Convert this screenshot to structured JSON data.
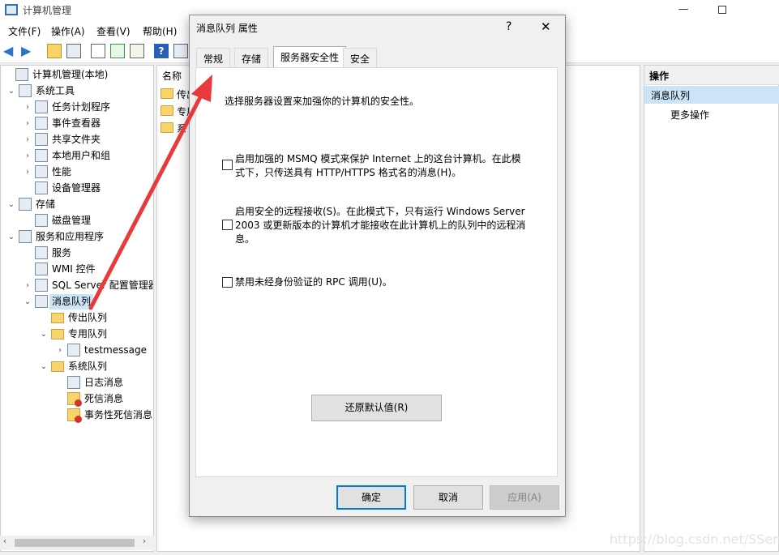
{
  "app": {
    "title": "计算机管理"
  },
  "menu": [
    "文件(F)",
    "操作(A)",
    "查看(V)",
    "帮助(H)"
  ],
  "tree": {
    "items": [
      {
        "label": "计算机管理(本地)",
        "chev": "",
        "level": 0,
        "icon": "computer-icon"
      },
      {
        "label": "系统工具",
        "chev": "⌄",
        "level": 1,
        "icon": "tools-icon"
      },
      {
        "label": "任务计划程序",
        "chev": "›",
        "level": 2,
        "icon": "clock-icon"
      },
      {
        "label": "事件查看器",
        "chev": "›",
        "level": 2,
        "icon": "event-viewer-icon"
      },
      {
        "label": "共享文件夹",
        "chev": "›",
        "level": 2,
        "icon": "shared-folder-icon"
      },
      {
        "label": "本地用户和组",
        "chev": "›",
        "level": 2,
        "icon": "users-icon"
      },
      {
        "label": "性能",
        "chev": "›",
        "level": 2,
        "icon": "performance-icon"
      },
      {
        "label": "设备管理器",
        "chev": "",
        "level": 2,
        "icon": "device-manager-icon"
      },
      {
        "label": "存储",
        "chev": "⌄",
        "level": 1,
        "icon": "storage-icon"
      },
      {
        "label": "磁盘管理",
        "chev": "",
        "level": 2,
        "icon": "disk-icon"
      },
      {
        "label": "服务和应用程序",
        "chev": "⌄",
        "level": 1,
        "icon": "services-apps-icon"
      },
      {
        "label": "服务",
        "chev": "",
        "level": 2,
        "icon": "gear-icon"
      },
      {
        "label": "WMI 控件",
        "chev": "",
        "level": 2,
        "icon": "wmi-icon"
      },
      {
        "label": "SQL Server 配置管理器",
        "chev": "›",
        "level": 2,
        "icon": "sql-server-icon"
      },
      {
        "label": "消息队列",
        "chev": "⌄",
        "level": 2,
        "icon": "message-queue-icon",
        "selected": true
      },
      {
        "label": "传出队列",
        "chev": "",
        "level": 3,
        "icon": "folder-icon"
      },
      {
        "label": "专用队列",
        "chev": "⌄",
        "level": 3,
        "icon": "folder-icon"
      },
      {
        "label": "testmessage",
        "chev": "›",
        "level": 4,
        "icon": "queue-icon"
      },
      {
        "label": "系统队列",
        "chev": "⌄",
        "level": 3,
        "icon": "folder-icon"
      },
      {
        "label": "日志消息",
        "chev": "",
        "level": 4,
        "icon": "journal-queue-icon"
      },
      {
        "label": "死信消息",
        "chev": "",
        "level": 4,
        "icon": "dead-letter-icon"
      },
      {
        "label": "事务性死信消息",
        "chev": "",
        "level": 4,
        "icon": "dead-letter-icon"
      }
    ]
  },
  "center": {
    "column_name": "名称",
    "rows": [
      "传出",
      "专用",
      "系"
    ]
  },
  "actions": {
    "header": "操作",
    "selected": "消息队列",
    "more": "更多操作"
  },
  "dialog": {
    "title": "消息队列 属性",
    "help": "?",
    "close": "✕",
    "tabs": [
      "常规",
      "存储",
      "服务器安全性",
      "安全"
    ],
    "active_tab": "服务器安全性",
    "description": "选择服务器设置来加强你的计算机的安全性。",
    "options": [
      {
        "line1": "启用加强的 MSMQ 模式来保护 Internet 上的这台计算机。在此模",
        "line2": "式下，只传送具有 HTTP/HTTPS 格式名的消息(H)。",
        "line3": "",
        "checked": false
      },
      {
        "line1": "启用安全的远程接收(S)。在此模式下，只有运行 Windows Server",
        "line2": "2003 或更新版本的计算机才能接收在此计算机上的队列中的远程消",
        "line3": "息。",
        "checked": false
      },
      {
        "line1": "禁用未经身份验证的 RPC 调用(U)。",
        "line2": "",
        "line3": "",
        "checked": false
      }
    ],
    "restore_button": "还原默认值(R)",
    "ok_button": "确定",
    "cancel_button": "取消",
    "apply_button": "应用(A)"
  },
  "watermark": "https://blog.csdn.net/SSenW",
  "colors": {
    "selection": "#cce4f7",
    "accent": "#0078d7",
    "arrow": "#e8393b",
    "folder": "#f7d56b"
  }
}
